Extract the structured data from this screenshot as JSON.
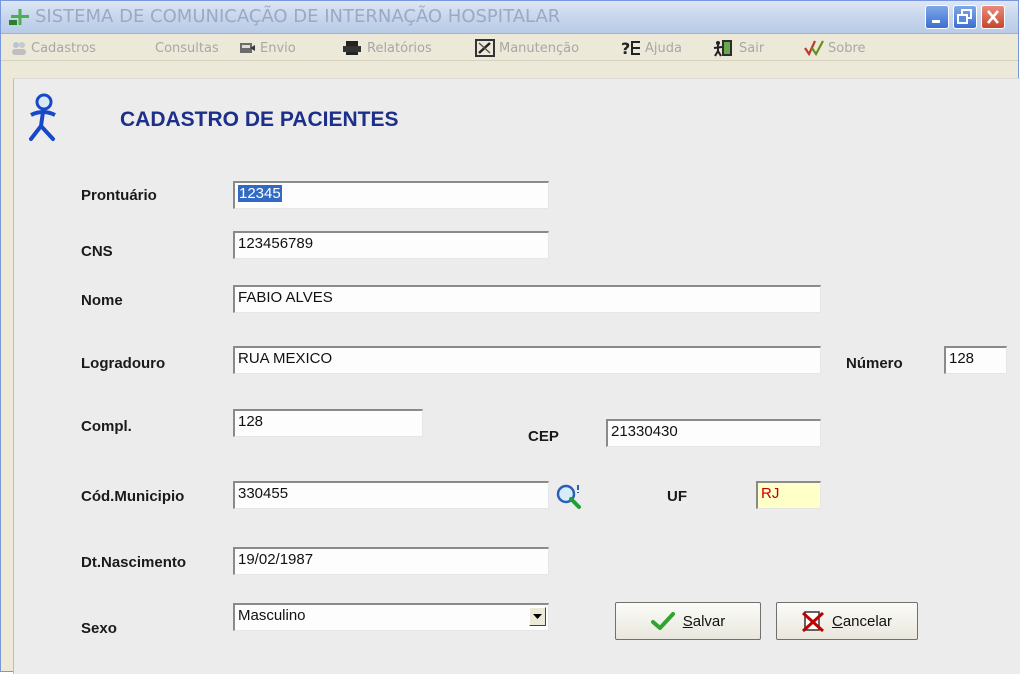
{
  "window": {
    "title": "SISTEMA DE COMUNICAÇÃO DE INTERNAÇÃO HOSPITALAR",
    "controls": [
      "minimize",
      "restore",
      "close"
    ]
  },
  "menu": {
    "items": [
      {
        "label": "Cadastros",
        "icon": "people-icon"
      },
      {
        "label": "Consultas",
        "icon": ""
      },
      {
        "label": "Envio",
        "icon": "send-icon"
      },
      {
        "label": "Relatórios",
        "icon": "printer-icon"
      },
      {
        "label": "Manutenção",
        "icon": "tools-icon"
      },
      {
        "label": "Ajuda",
        "icon": "help-icon"
      },
      {
        "label": "Sair",
        "icon": "exit-door-icon"
      },
      {
        "label": "Sobre",
        "icon": "check-marks-icon"
      }
    ]
  },
  "header": {
    "title": "CADASTRO DE PACIENTES",
    "icon": "walking-person-icon"
  },
  "form": {
    "prontuario": {
      "label": "Prontuário",
      "value": "12345",
      "selected": true
    },
    "cns": {
      "label": "CNS",
      "value": "123456789"
    },
    "nome": {
      "label": "Nome",
      "value": "FABIO ALVES"
    },
    "logradouro": {
      "label": "Logradouro",
      "value": "RUA MEXICO"
    },
    "numero": {
      "label": "Número",
      "value": "128"
    },
    "compl": {
      "label": "Compl.",
      "value": "128"
    },
    "cep": {
      "label": "CEP",
      "value": "21330430"
    },
    "cod_municipio": {
      "label": "Cód.Municipio",
      "value": "330455"
    },
    "uf": {
      "label": "UF",
      "value": "RJ"
    },
    "dt_nascimento": {
      "label": "Dt.Nascimento",
      "value": "19/02/1987"
    },
    "sexo": {
      "label": "Sexo",
      "value": "Masculino"
    }
  },
  "buttons": {
    "save": {
      "mnemonic": "S",
      "rest": "alvar"
    },
    "cancel": {
      "mnemonic": "C",
      "rest": "ancelar"
    }
  },
  "colors": {
    "title_text": "#1c2f8a",
    "uf_background": "#ffffc8",
    "uf_text": "#c00000",
    "selection": "#316ac5"
  }
}
